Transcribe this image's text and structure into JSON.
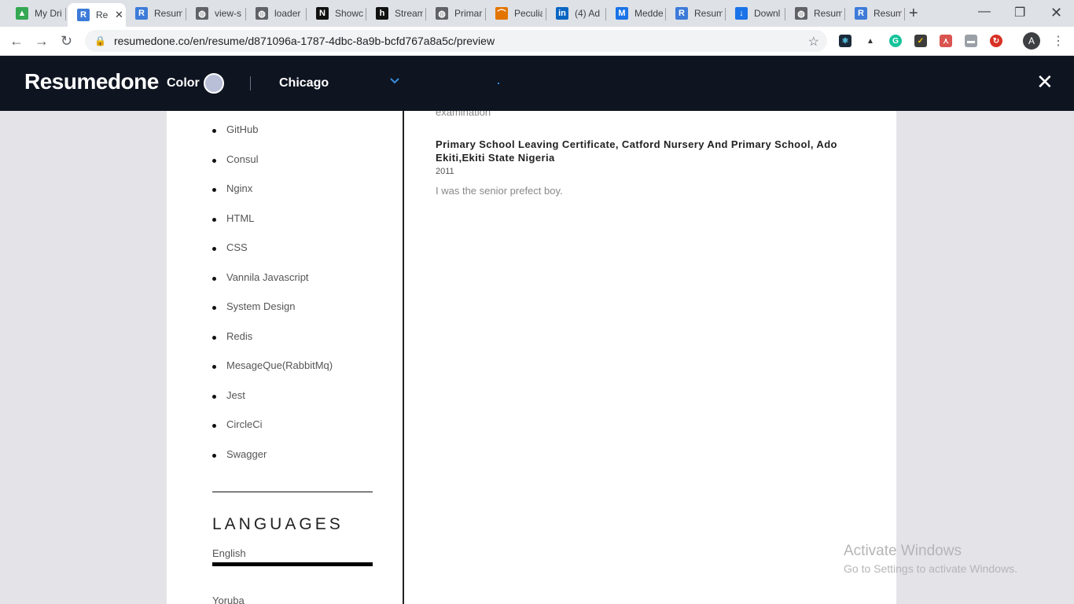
{
  "browser": {
    "tabs": [
      {
        "label": "My Dri",
        "icon": "drive-icon",
        "color": "#34a853",
        "glyph": "▲"
      },
      {
        "label": "Res",
        "icon": "resumedone-icon",
        "color": "#3d7bd9",
        "glyph": "R",
        "active": true
      },
      {
        "label": "Resum",
        "icon": "resumedone-icon",
        "color": "#3d7bd9",
        "glyph": "R"
      },
      {
        "label": "view-s",
        "icon": "globe-icon",
        "color": "#5f6368",
        "glyph": "◍"
      },
      {
        "label": "loader",
        "icon": "globe-icon",
        "color": "#5f6368",
        "glyph": "◍"
      },
      {
        "label": "Showc",
        "icon": "notion-icon",
        "color": "#111111",
        "glyph": "N"
      },
      {
        "label": "Stream",
        "icon": "hackerrank-icon",
        "color": "#111111",
        "glyph": "h"
      },
      {
        "label": "Primar",
        "icon": "globe-icon",
        "color": "#5f6368",
        "glyph": "◍"
      },
      {
        "label": "Peculia",
        "icon": "rainbow-icon",
        "color": "#e37400",
        "glyph": "⌒"
      },
      {
        "label": "(4) Ad",
        "icon": "linkedin-icon",
        "color": "#0a66c2",
        "glyph": "in"
      },
      {
        "label": "Medde",
        "icon": "meddle-icon",
        "color": "#1a73e8",
        "glyph": "M"
      },
      {
        "label": "Resum",
        "icon": "resumedone-icon",
        "color": "#3d7bd9",
        "glyph": "R"
      },
      {
        "label": "Downl",
        "icon": "download-icon",
        "color": "#1a73e8",
        "glyph": "↓"
      },
      {
        "label": "Resum",
        "icon": "globe-icon",
        "color": "#5f6368",
        "glyph": "◍"
      },
      {
        "label": "Resum",
        "icon": "resumedone-icon",
        "color": "#3d7bd9",
        "glyph": "R"
      }
    ],
    "url": "resumedone.co/en/resume/d871096a-1787-4dbc-8a9b-bcfd767a8a5c/preview",
    "avatar_letter": "A"
  },
  "app": {
    "brand": "Resumedone",
    "color_label": "Color",
    "color_value": "#b8bfd6",
    "template": "Chicago"
  },
  "resume": {
    "skills": [
      "GitHub",
      "Consul",
      "Nginx",
      "HTML",
      "CSS",
      "Vannila Javascript",
      "System Design",
      "Redis",
      "MesageQue(RabbitMq)",
      "Jest",
      "CircleCi",
      "Swagger"
    ],
    "languages_heading": "LANGUAGES",
    "languages": [
      "English",
      "Yoruba"
    ],
    "clipped_text": "examination",
    "education": {
      "title": "Primary School Leaving Certificate, Catford Nursery And Primary School, Ado Ekiti,Ekiti State Nigeria",
      "year": "2011",
      "description": "I was the senior prefect boy."
    }
  },
  "watermark": {
    "line1": "Activate Windows",
    "line2": "Go to Settings to activate Windows."
  }
}
